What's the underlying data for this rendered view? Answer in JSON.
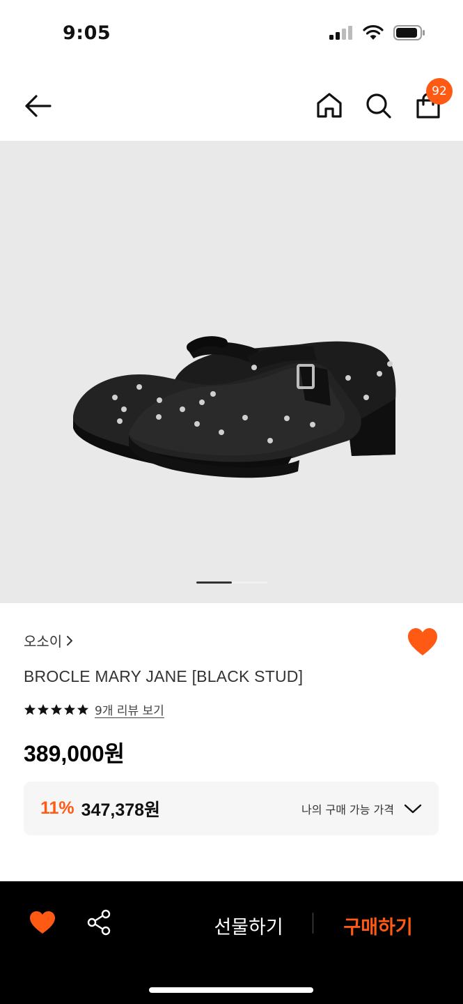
{
  "status_bar": {
    "time": "9:05"
  },
  "nav": {
    "cart_count": "92"
  },
  "colors": {
    "accent": "#ff5a14",
    "image_bg": "#e9e9e9",
    "bottom_bar": "#000000"
  },
  "gallery": {
    "current_progress": 0.5
  },
  "product": {
    "brand": "오소이",
    "name": "BROCLE MARY JANE [BLACK STUD]",
    "rating_stars": 5,
    "review_link": "9개 리뷰 보기",
    "price": "389,000원"
  },
  "my_price": {
    "discount": "11%",
    "price": "347,378원",
    "label": "나의 구매 가능 가격"
  },
  "bottom_bar": {
    "gift_label": "선물하기",
    "buy_label": "구매하기"
  },
  "icons": [
    "back-arrow-icon",
    "home-icon",
    "search-icon",
    "shopping-bag-icon",
    "heart-icon",
    "share-icon",
    "chevron-down-icon",
    "star-icon",
    "chevron-right-icon"
  ]
}
